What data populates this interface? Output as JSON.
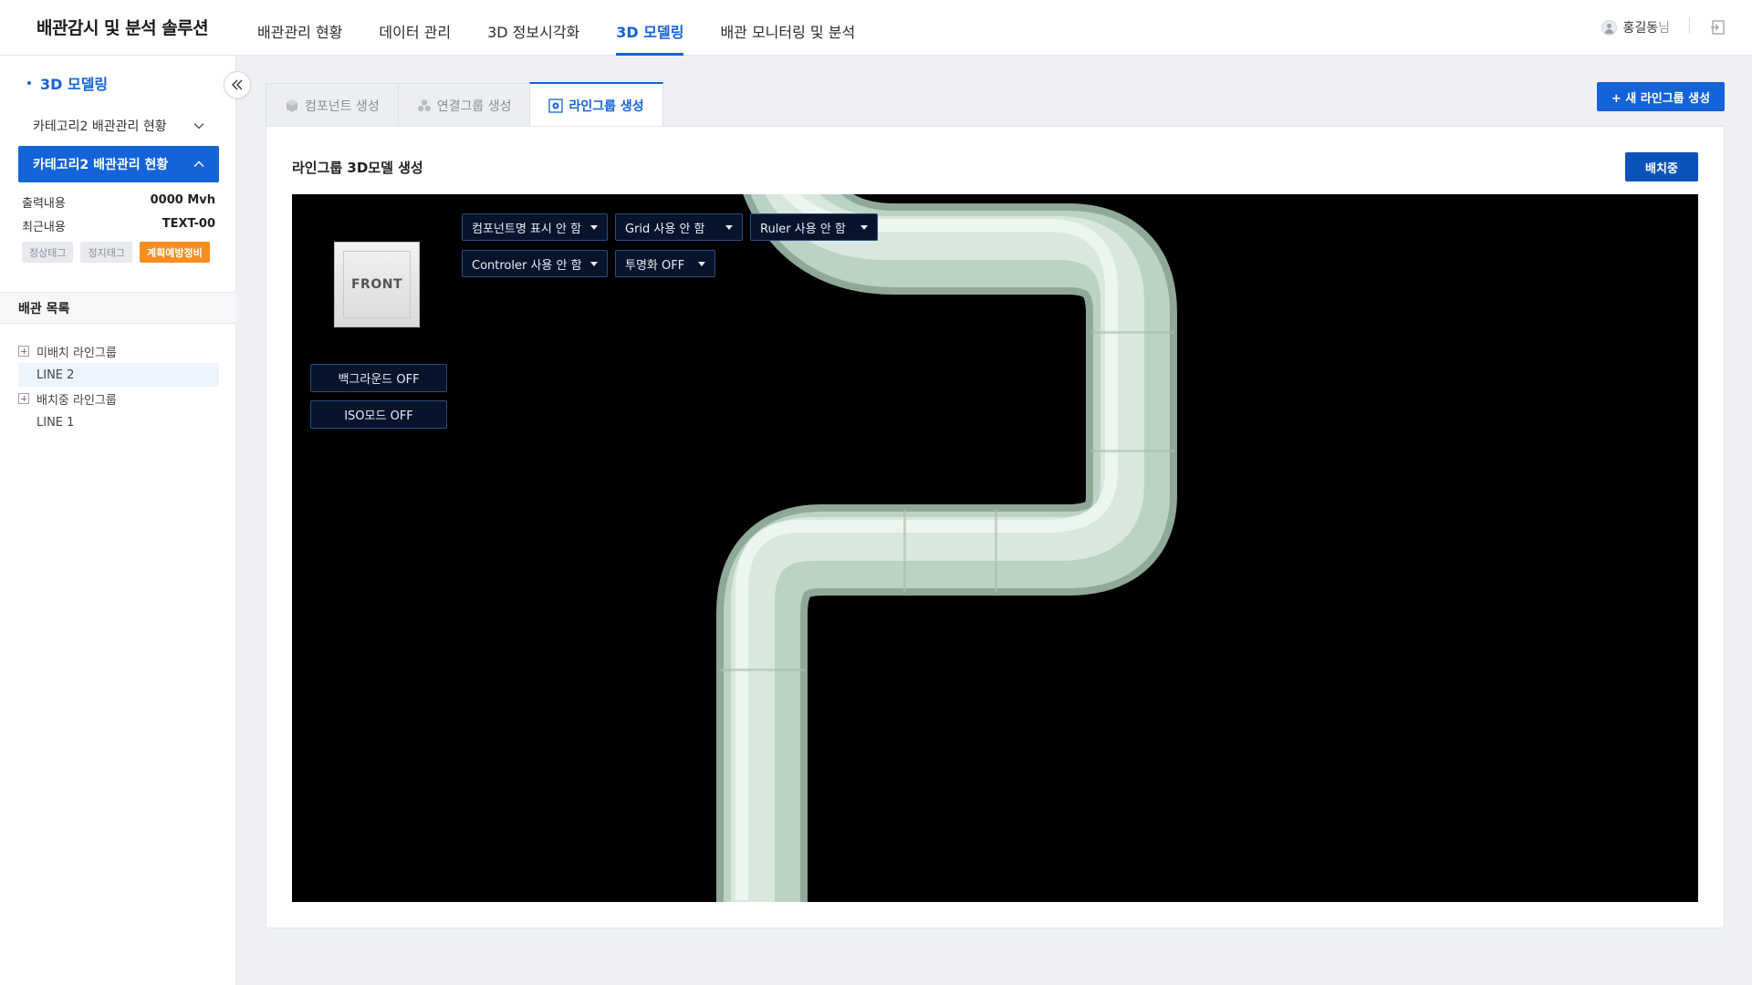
{
  "app": {
    "title": "배관감시 및 분석 솔루션"
  },
  "nav": {
    "items": [
      {
        "label": "배관관리 현황"
      },
      {
        "label": "데이터 관리"
      },
      {
        "label": "3D 정보시각화"
      },
      {
        "label": "3D 모델링"
      },
      {
        "label": "배관 모니터링 및 분석"
      }
    ],
    "active_index": 3
  },
  "user": {
    "name": "홍길동",
    "suffix": "님"
  },
  "icons": {
    "logout": "logout-icon",
    "collapse": "double-chevron-left-icon",
    "user": "user-avatar-icon",
    "component_tab": "cube-icon",
    "group_tab": "cluster-icon",
    "line_tab": "target-icon"
  },
  "sidebar": {
    "section_title": "3D 모델링",
    "categories": [
      {
        "label": "카테고리2 배관관리 현황",
        "expanded": false
      },
      {
        "label": "카테고리2 배관관리 현황",
        "expanded": true
      }
    ],
    "info": [
      {
        "key": "출력내용",
        "value": "0000 Mvh"
      },
      {
        "key": "최근내용",
        "value": "TEXT-00"
      }
    ],
    "tags": [
      "정상태그",
      "정지태그",
      "계획예방정비"
    ],
    "list_title": "배관 목록",
    "tree": [
      {
        "label": "미배치 라인그룹",
        "type": "group"
      },
      {
        "label": "LINE 2",
        "type": "item",
        "selected": true
      },
      {
        "label": "배치중 라인그룹",
        "type": "group"
      },
      {
        "label": "LINE 1",
        "type": "item",
        "selected": false
      }
    ]
  },
  "tabs": [
    {
      "label": "컴포넌트 생성"
    },
    {
      "label": "연결그룹 생성"
    },
    {
      "label": "라인그룹 생성"
    }
  ],
  "active_tab": 2,
  "new_button": "+ 새 라인그룹 생성",
  "card": {
    "title": "라인그룹 3D모델 생성",
    "place_button": "배치중"
  },
  "viewer": {
    "view_cube_label": "FRONT",
    "dropdowns": [
      {
        "label": "컴포넌트명 표시 안 함"
      },
      {
        "label": "Grid 사용 안 함"
      },
      {
        "label": "Ruler 사용 안 함"
      },
      {
        "label": "Controler 사용 안 함"
      },
      {
        "label": "투명화 OFF"
      }
    ],
    "buttons": [
      {
        "label": "백그라운드 OFF"
      },
      {
        "label": "ISO모드 OFF"
      }
    ],
    "background": "#000000",
    "pipe_color": "#cfe3d6"
  },
  "colors": {
    "accent": "#1463d8",
    "dark_button": "#0b53b8",
    "tag_orange": "#f78e1e"
  }
}
